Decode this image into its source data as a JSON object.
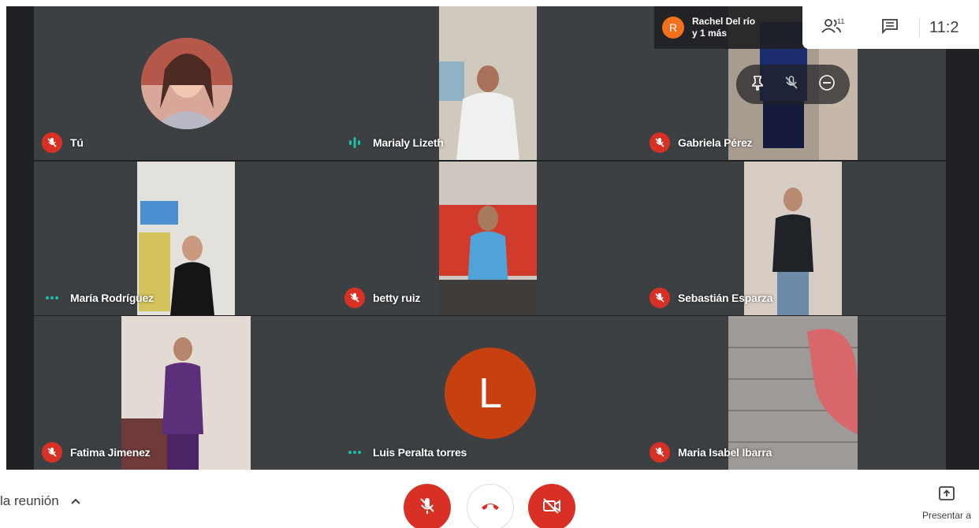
{
  "participants": [
    {
      "name": "Tú",
      "status": "muted",
      "avatar": "photo"
    },
    {
      "name": "Marialy Lizeth",
      "status": "speaking"
    },
    {
      "name": "Gabriela Pérez",
      "status": "muted"
    },
    {
      "name": "María Rodríguez",
      "status": "dots"
    },
    {
      "name": "betty ruiz",
      "status": "muted"
    },
    {
      "name": "Sebastián Esparza",
      "status": "muted"
    },
    {
      "name": "Fatima Jimenez",
      "status": "muted"
    },
    {
      "name": "Luis Peralta torres",
      "status": "dots",
      "avatar_letter": "L"
    },
    {
      "name": "Maria Isabel Ibarra",
      "status": "muted"
    }
  ],
  "host": {
    "initial": "R",
    "line1": "Rachel Del río",
    "line2": "y 1 más"
  },
  "top_bar": {
    "participant_count": "11",
    "clock": "11:2",
    "icons": [
      "people-icon",
      "chat-icon"
    ]
  },
  "hover_controls": [
    "pin-icon",
    "mute-icon",
    "remove-icon"
  ],
  "bottom_bar": {
    "meeting_details_label": "la reunión",
    "present_label": "Presentar a",
    "controls": [
      "mic-off-icon",
      "hang-up-icon",
      "camera-off-icon"
    ]
  },
  "colors": {
    "muted_red": "#d93025",
    "speaking_teal": "#1ac1a6",
    "avatar_orange": "#c6410f",
    "host_orange": "#f2711c",
    "tile_bg": "#3c4043"
  }
}
